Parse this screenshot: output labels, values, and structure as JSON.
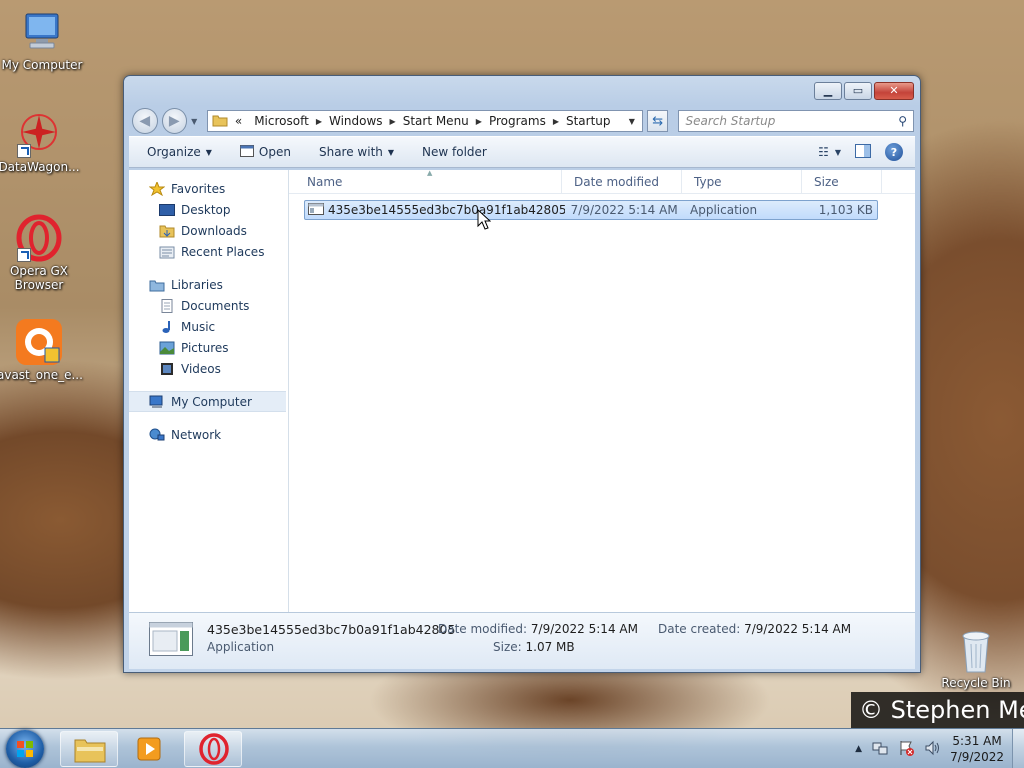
{
  "desktop": {
    "icons": [
      {
        "label": "My Computer"
      },
      {
        "label": "DataWagon..."
      },
      {
        "label": "Opera GX Browser"
      },
      {
        "label": "avast_one_e..."
      }
    ],
    "recycle_bin": "Recycle Bin",
    "watermark": "© Stephen Me"
  },
  "window": {
    "breadcrumb_prefix": "«",
    "breadcrumb": [
      "Microsoft",
      "Windows",
      "Start Menu",
      "Programs",
      "Startup"
    ],
    "search_placeholder": "Search Startup",
    "toolbar": {
      "organize": "Organize",
      "open": "Open",
      "share_with": "Share with",
      "new_folder": "New folder"
    },
    "nav": {
      "favorites": "Favorites",
      "desktop": "Desktop",
      "downloads": "Downloads",
      "recent_places": "Recent Places",
      "libraries": "Libraries",
      "documents": "Documents",
      "music": "Music",
      "pictures": "Pictures",
      "videos": "Videos",
      "my_computer": "My Computer",
      "network": "Network"
    },
    "columns": {
      "name": "Name",
      "date_modified": "Date modified",
      "type": "Type",
      "size": "Size"
    },
    "files": [
      {
        "name": "435e3be14555ed3bc7b0a91f1ab42805",
        "date_modified": "7/9/2022 5:14 AM",
        "type": "Application",
        "size": "1,103 KB"
      }
    ],
    "details": {
      "name": "435e3be14555ed3bc7b0a91f1ab42805",
      "type": "Application",
      "date_modified_label": "Date modified:",
      "date_modified": "7/9/2022 5:14 AM",
      "size_label": "Size:",
      "size": "1.07 MB",
      "date_created_label": "Date created:",
      "date_created": "7/9/2022 5:14 AM"
    }
  },
  "taskbar": {
    "time": "5:31 AM",
    "date": "7/9/2022"
  },
  "colors": {
    "selection": "#c1dbfc",
    "taskbar": "#aac3dc",
    "title_glass": "#b9cde6"
  }
}
